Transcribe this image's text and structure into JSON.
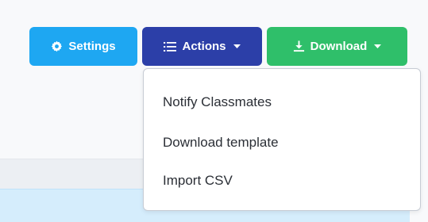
{
  "toolbar": {
    "settings": {
      "label": "Settings",
      "icon": "gear-icon",
      "color": "#1ea7f2"
    },
    "actions": {
      "label": "Actions",
      "icon": "list-icon",
      "color": "#2c3fa8",
      "menu_open": true
    },
    "download": {
      "label": "Download",
      "icon": "download-icon",
      "color": "#2fbf6a"
    }
  },
  "actions_menu": {
    "items": [
      {
        "label": "Notify Classmates"
      },
      {
        "label": "Download template"
      },
      {
        "label": "Import CSV"
      }
    ]
  }
}
